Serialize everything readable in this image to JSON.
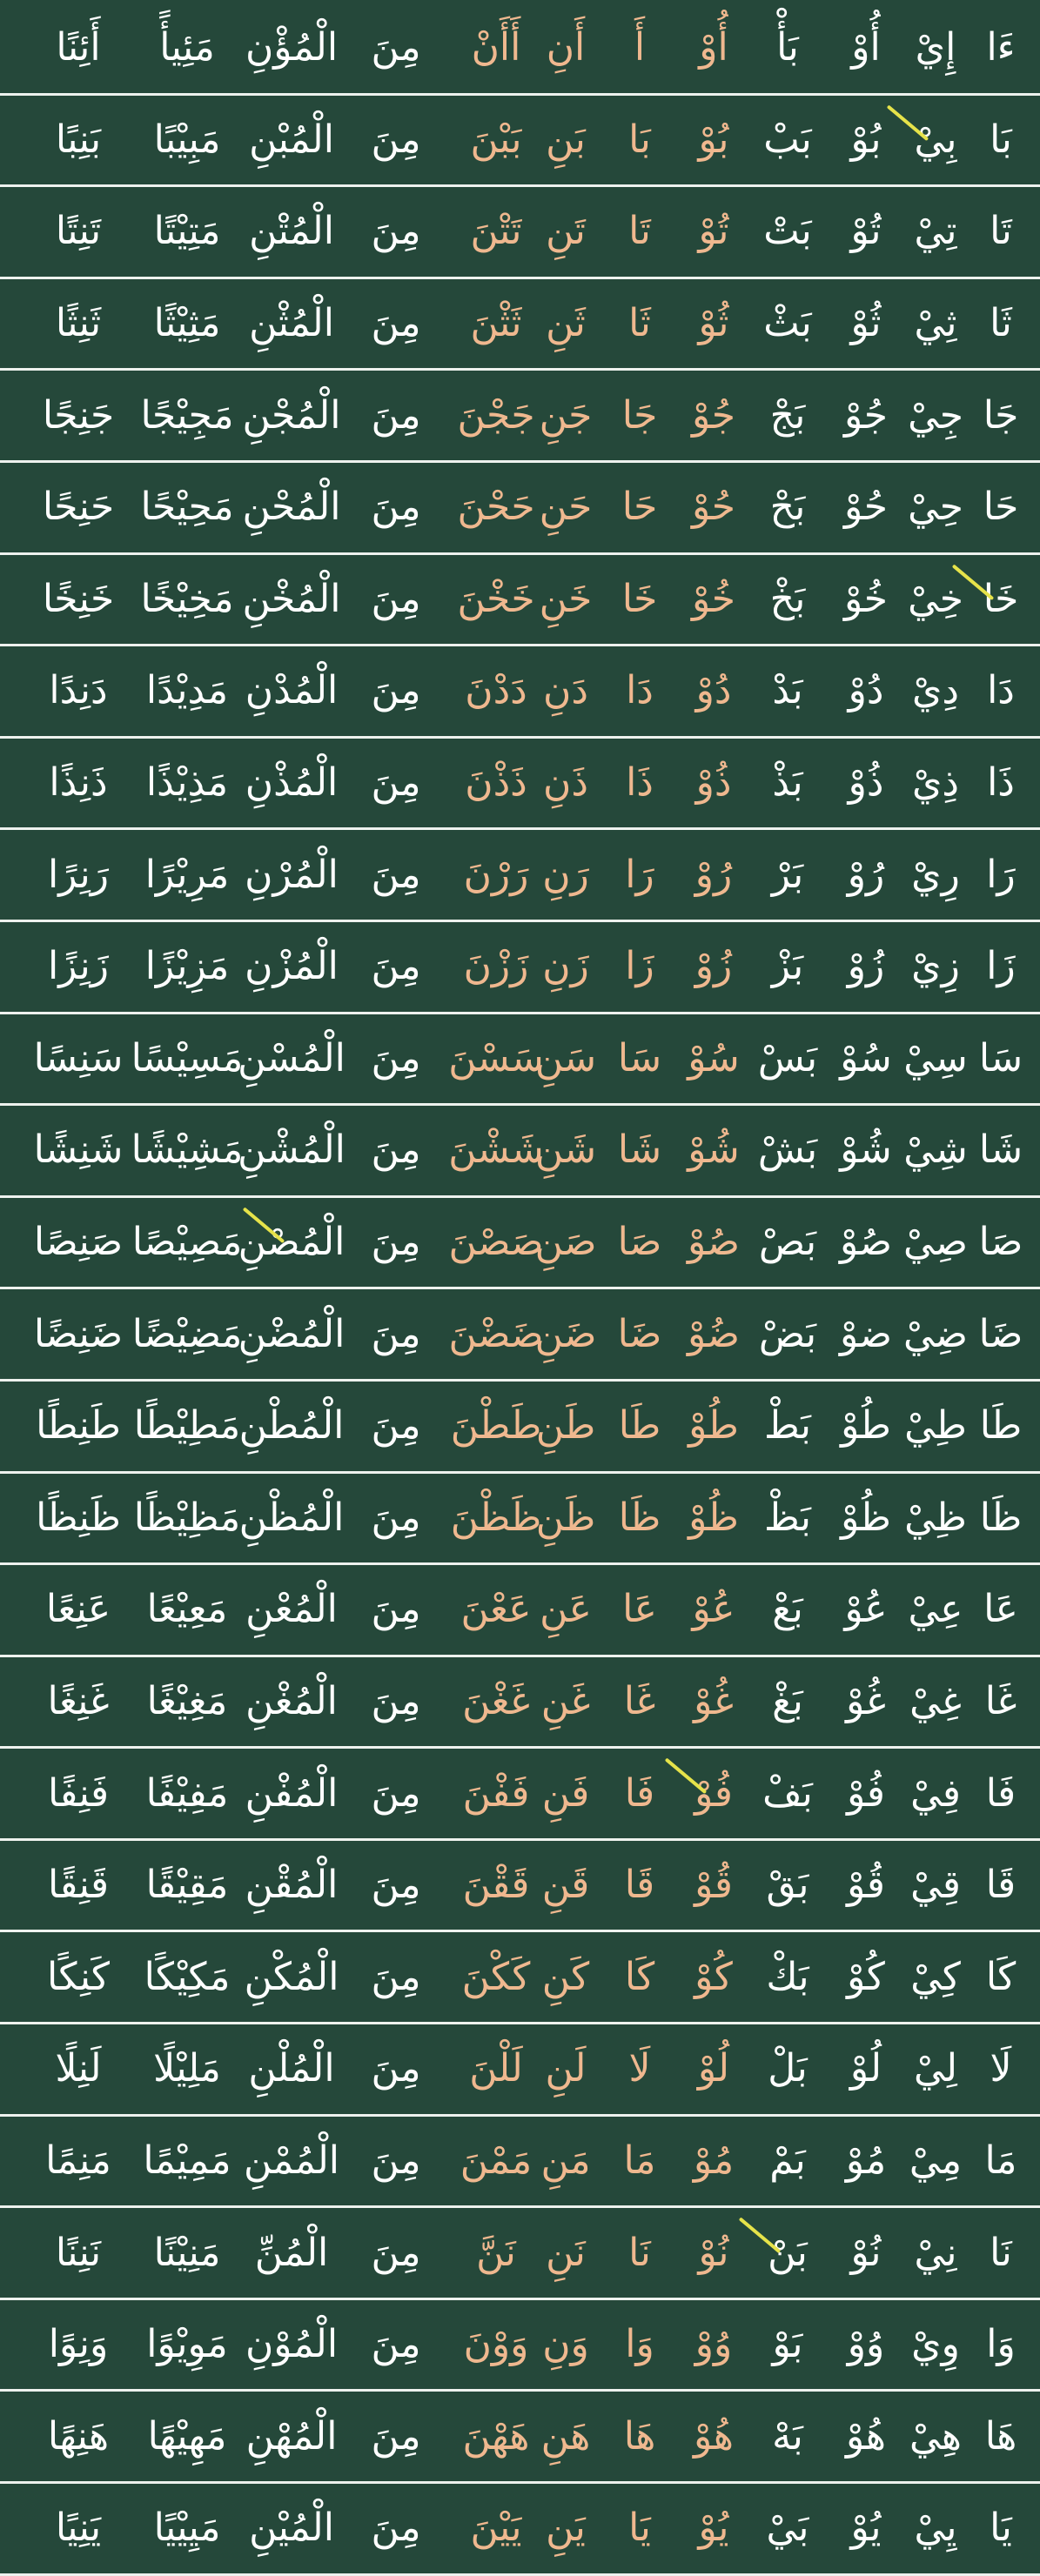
{
  "colors": {
    "background": "#25483a",
    "base_text": "#ffffff",
    "highlight_text": "#efb88f",
    "rule_lines": "#eef2ee",
    "pointer": "#e6e34a"
  },
  "rows": [
    [
      "ءَا",
      "إِيْ",
      "أُوْ",
      "بَأْ",
      "أُوْ",
      "أَ",
      "أَنِ",
      "أَأَنْ",
      "مِنَ",
      "الْمُؤْنِ",
      "مَئِيأً",
      "أَئِنًا"
    ],
    [
      "بَا",
      "بِيْ",
      "بُوْ",
      "بَبْ",
      "بُوْ",
      "بَا",
      "بَنِ",
      "بَبْنَ",
      "مِنَ",
      "الْمُبْنِ",
      "مَبِيْبًا",
      "بَنِبًا"
    ],
    [
      "تَا",
      "تِيْ",
      "تُوْ",
      "بَتْ",
      "تُوْ",
      "تَا",
      "تَنِ",
      "تَتْنَ",
      "مِنَ",
      "الْمُتْنِ",
      "مَتِيْتًا",
      "تَنِتًا"
    ],
    [
      "ثَا",
      "ثِيْ",
      "ثُوْ",
      "بَثْ",
      "ثُوْ",
      "ثَا",
      "ثَنِ",
      "ثَثْنَ",
      "مِنَ",
      "الْمُثْنِ",
      "مَثِيْثًا",
      "ثَنِثًا"
    ],
    [
      "جَا",
      "جِيْ",
      "جُوْ",
      "بَجْ",
      "جُوْ",
      "جَا",
      "جَنِ",
      "جَجْنَ",
      "مِنَ",
      "الْمُجْنِ",
      "مَجِيْجًا",
      "جَنِجًا"
    ],
    [
      "حَا",
      "حِيْ",
      "حُوْ",
      "بَحْ",
      "حُوْ",
      "حَا",
      "حَنِ",
      "حَحْنَ",
      "مِنَ",
      "الْمُحْنِ",
      "مَحِيْحًا",
      "حَنِحًا"
    ],
    [
      "خَا",
      "خِيْ",
      "خُوْ",
      "بَخْ",
      "خُوْ",
      "خَا",
      "خَنِ",
      "خَخْنَ",
      "مِنَ",
      "الْمُخْنِ",
      "مَخِيْخًا",
      "خَنِخًا"
    ],
    [
      "دَا",
      "دِيْ",
      "دُوْ",
      "بَدْ",
      "دُوْ",
      "دَا",
      "دَنِ",
      "دَدْنَ",
      "مِنَ",
      "الْمُدْنِ",
      "مَدِيْدًا",
      "دَنِدًا"
    ],
    [
      "ذَا",
      "ذِيْ",
      "ذُوْ",
      "بَذْ",
      "ذُوْ",
      "ذَا",
      "ذَنِ",
      "ذَذْنَ",
      "مِنَ",
      "الْمُذْنِ",
      "مَذِيْذًا",
      "ذَنِذًا"
    ],
    [
      "رَا",
      "رِيْ",
      "رُوْ",
      "بَرْ",
      "رُوْ",
      "رَا",
      "رَنِ",
      "رَرْنَ",
      "مِنَ",
      "الْمُرْنِ",
      "مَرِيْرًا",
      "رَنِرًا"
    ],
    [
      "زَا",
      "زِيْ",
      "زُوْ",
      "بَزْ",
      "زُوْ",
      "زَا",
      "زَنِ",
      "زَزْنَ",
      "مِنَ",
      "الْمُزْنِ",
      "مَزِيْزًا",
      "زَنِزًا"
    ],
    [
      "سَا",
      "سِيْ",
      "سُوْ",
      "بَسْ",
      "سُوْ",
      "سَا",
      "سَنِ",
      "سَسْنَ",
      "مِنَ",
      "الْمُسْنِ",
      "مَسِيْسًا",
      "سَنِسًا"
    ],
    [
      "شَا",
      "شِيْ",
      "شُوْ",
      "بَشْ",
      "شُوْ",
      "شَا",
      "شَنِ",
      "شَشْنَ",
      "مِنَ",
      "الْمُشْنِ",
      "مَشِيْشًا",
      "شَنِشًا"
    ],
    [
      "صَا",
      "صِيْ",
      "صُوْ",
      "بَصْ",
      "صُوْ",
      "صَا",
      "صَنِ",
      "صَصْنَ",
      "مِنَ",
      "الْمُصْنِ",
      "مَصِيْصًا",
      "صَنِصًا"
    ],
    [
      "ضَا",
      "ضِيْ",
      "ضوْ",
      "بَضْ",
      "ضُوْ",
      "ضَا",
      "ضَنِ",
      "ضَضْنَ",
      "مِنَ",
      "الْمُضْنِ",
      "مَضِيْضًا",
      "ضَنِضًا"
    ],
    [
      "طَا",
      "طِيْ",
      "طُوْ",
      "بَطْ",
      "طُوْ",
      "طَا",
      "طَنِ",
      "طَطْنَ",
      "مِنَ",
      "الْمُطْنِ",
      "مَطِيْطًا",
      "طَنِطًا"
    ],
    [
      "ظَا",
      "ظِيْ",
      "ظُوْ",
      "بَظْ",
      "ظُوْ",
      "ظَا",
      "ظَنِ",
      "ظَظْنَ",
      "مِنَ",
      "الْمُظْنِ",
      "مَظِيْظًا",
      "ظَنِظًا"
    ],
    [
      "عَا",
      "عِيْ",
      "عُوْ",
      "بَعْ",
      "عُوْ",
      "عَا",
      "عَنِ",
      "عَعْنَ",
      "مِنَ",
      "الْمُعْنِ",
      "مَعِيْعًا",
      "عَنِعًا"
    ],
    [
      "غَا",
      "غِيْ",
      "غُوْ",
      "بَغْ",
      "غُوْ",
      "غَا",
      "غَنِ",
      "غَغْنَ",
      "مِنَ",
      "الْمُغْنِ",
      "مَغِيْغًا",
      "غَنِغًا"
    ],
    [
      "فَا",
      "فِيْ",
      "فُوْ",
      "بَفْ",
      "فُوْ",
      "فَا",
      "فَنِ",
      "فَفْنَ",
      "مِنَ",
      "الْمُفْنِ",
      "مَفِيْفًا",
      "فَنِفًا"
    ],
    [
      "قَا",
      "قِيْ",
      "قُوْ",
      "بَقْ",
      "قُوْ",
      "قَا",
      "قَنِ",
      "قَقْنَ",
      "مِنَ",
      "الْمُقْنِ",
      "مَقِيْقًا",
      "قَنِقًا"
    ],
    [
      "كَا",
      "كِيْ",
      "كُوْ",
      "بَكْ",
      "كُوْ",
      "كَا",
      "كَنِ",
      "كَكْنَ",
      "مِنَ",
      "الْمُكْنِ",
      "مَكِيْكًا",
      "كَنِكًا"
    ],
    [
      "لَا",
      "لِيْ",
      "لُوْ",
      "بَلْ",
      "لُوْ",
      "لَا",
      "لَنِ",
      "لَلْنَ",
      "مِنَ",
      "الْمُلْنِ",
      "مَلِيْلًا",
      "لَنِلًا"
    ],
    [
      "مَا",
      "مِيْ",
      "مُوْ",
      "بَمْ",
      "مُوْ",
      "مَا",
      "مَنِ",
      "مَمْنَ",
      "مِنَ",
      "الْمُمْنِ",
      "مَمِيْمًا",
      "مَنِمًا"
    ],
    [
      "نَا",
      "نِيْ",
      "نُوْ",
      "بَنْ",
      "نُوْ",
      "نَا",
      "نَنِ",
      "نَنَّ",
      "مِنَ",
      "الْمُنِّ",
      "مَنِيْنًا",
      "نَنِنًا"
    ],
    [
      "وَا",
      "وِيْ",
      "وُوْ",
      "بَوْ",
      "وُوْ",
      "وَا",
      "وَنِ",
      "وَوْنَ",
      "مِنَ",
      "الْمُوْنِ",
      "مَوِيْوًا",
      "وَنِوًا"
    ],
    [
      "هَا",
      "هِيْ",
      "هُوْ",
      "بَهْ",
      "هُوْ",
      "هَا",
      "هَنِ",
      "هَهْنَ",
      "مِنَ",
      "الْمُهْنِ",
      "مَهِيْهًا",
      "هَنِهًا"
    ],
    [
      "يَا",
      "يِيْ",
      "يُوْ",
      "بَيْ",
      "يُوْ",
      "يَا",
      "يَنِ",
      "يَيْنَ",
      "مِنَ",
      "الْمُيْنِ",
      "مَيِيْيًا",
      "يَنِيًا"
    ]
  ],
  "highlight_columns": [
    4,
    5,
    6,
    7
  ],
  "pointers": [
    {
      "row": 1,
      "col": 1
    },
    {
      "row": 6,
      "col": 0
    },
    {
      "row": 13,
      "col": 9
    },
    {
      "row": 19,
      "col": 4
    },
    {
      "row": 24,
      "col": 3
    }
  ]
}
